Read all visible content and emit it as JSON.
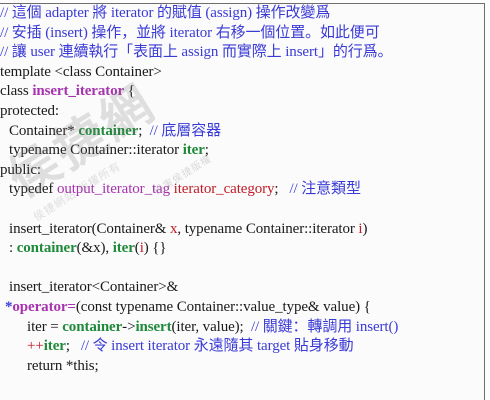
{
  "code": {
    "l1": "// 這個 adapter 將 iterator 的賦值 (assign) 操作改變爲",
    "l2": "// 安插 (insert) 操作，並將 iterator 右移一個位置。如此便可",
    "l3": "// 讓 user 連續執行「表面上 assign 而實際上 insert」的行爲。",
    "l4": "template <class Container>",
    "l5a": "class ",
    "l5b": "insert_iterator",
    "l5c": " {",
    "l6": "protected:",
    "l7a": "Container* ",
    "l7b": "container",
    "l7c": ";  ",
    "l7d": "// 底層容器",
    "l8a": "typename Container::iterator ",
    "l8b": "iter",
    "l8c": ";",
    "l9": "public:",
    "l10a": "typedef ",
    "l10b": "output_iterator_tag",
    "l10c": " ",
    "l10d": "iterator_category",
    "l10e": ";   ",
    "l10f": "// 注意類型",
    "l12a": "insert_iterator(Container& ",
    "l12b": "x",
    "l12c": ", typename Container::iterator ",
    "l12d": "i",
    "l12e": ")",
    "l13a": ": ",
    "l13b": "container",
    "l13c": "(&x), ",
    "l13d": "iter",
    "l13e": "(",
    "l13f": "i",
    "l13g": ") {}",
    "l15": "insert_iterator<Container>&",
    "l16m": "*",
    "l16a": "operator=",
    "l16b": "(const typename Container::value_type& value) {",
    "l17a": "iter = ",
    "l17b": "container",
    "l17c": "->",
    "l17d": "insert",
    "l17e": "(iter, value);  ",
    "l17f": "// 關鍵：轉調用 insert()",
    "l18a": "++",
    "l18b": "iter",
    "l18c": ";   ",
    "l18d": "// 令 insert iterator 永遠隨其 target 貼身移動",
    "l19": "return *this;"
  },
  "watermark": {
    "big": "侯捷網",
    "small": "侯捷網站 版權所有",
    "small2": "侵害侯捷版權"
  }
}
